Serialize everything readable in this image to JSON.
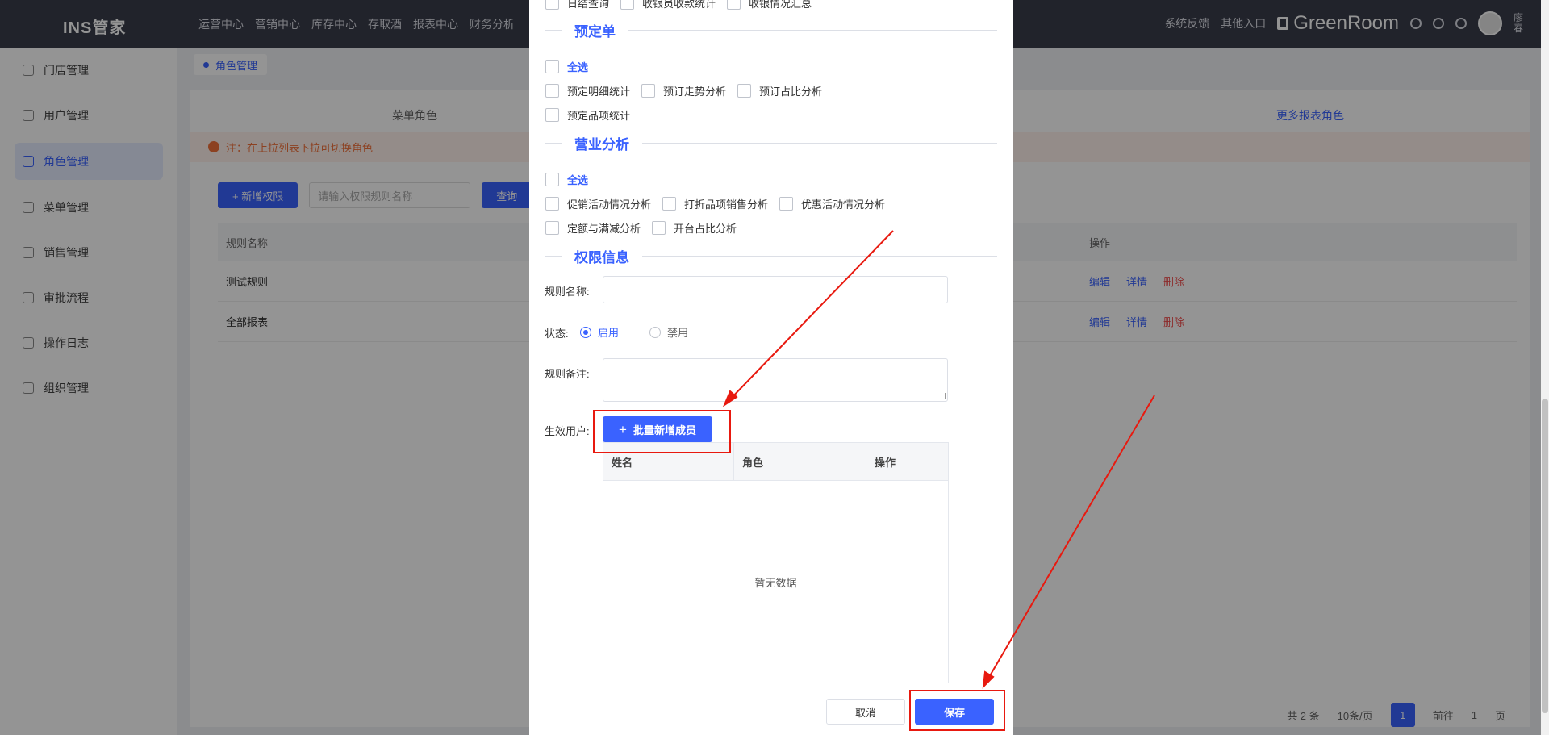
{
  "app": {
    "logo": "INS管家",
    "topnav": [
      "运营中心",
      "营销中心",
      "库存中心",
      "存取酒",
      "报表中心",
      "财务分析"
    ],
    "feedback": "系统反馈",
    "other_entry": "其他入口",
    "brand": "GreenRoom",
    "user": "廖春"
  },
  "sidebar": {
    "items": [
      {
        "label": "门店管理"
      },
      {
        "label": "用户管理"
      },
      {
        "label": "角色管理"
      },
      {
        "label": "菜单管理"
      },
      {
        "label": "销售管理"
      },
      {
        "label": "审批流程"
      },
      {
        "label": "操作日志"
      },
      {
        "label": "组织管理"
      }
    ]
  },
  "page": {
    "breadcrumb": "角色管理",
    "tab_left": "菜单角色",
    "tab_right": "更多报表角色",
    "notice": "注：在上拉列表下拉可切换角色",
    "add_button": "+ 新增权限",
    "search_placeholder": "请输入权限规则名称",
    "query_button": "查询",
    "table_headers": [
      "规则名称",
      "操作"
    ],
    "rows": [
      "测试规则",
      "全部报表"
    ],
    "ops": [
      "编辑",
      "详情",
      "删除"
    ],
    "pager": {
      "total": "共 2 条",
      "size": "10条/页",
      "current": "1",
      "goto": "前往",
      "goto_value": "1",
      "page_unit": "页"
    }
  },
  "modal": {
    "top_items": [
      "日结查询",
      "收银员收款统计",
      "收银情况汇总"
    ],
    "section_booking": "预定单",
    "select_all": "全选",
    "booking_items_row1": [
      "预定明细统计",
      "预订走势分析",
      "预订占比分析"
    ],
    "booking_items_row2": [
      "预定品项统计"
    ],
    "section_business": "营业分析",
    "business_items_row1": [
      "促销活动情况分析",
      "打折品项销售分析",
      "优惠活动情况分析"
    ],
    "business_items_row2": [
      "定额与满减分析",
      "开台占比分析"
    ],
    "section_permission": "权限信息",
    "rule_name_label": "规则名称:",
    "rule_name_value": "",
    "status_label": "状态:",
    "status_on": "启用",
    "status_off": "禁用",
    "status_selected": "启用",
    "remark_label": "规则备注:",
    "remark_value": "",
    "effective_users_label": "生效用户:",
    "batch_add_label": "批量新增成员",
    "member_table": {
      "headers": [
        "姓名",
        "角色",
        "操作"
      ],
      "empty_text": "暂无数据"
    },
    "cancel_label": "取消",
    "save_label": "保存"
  },
  "colors": {
    "primary": "#3a62ff",
    "annotation": "#e8190f",
    "topbar": "#3a3d4a"
  }
}
